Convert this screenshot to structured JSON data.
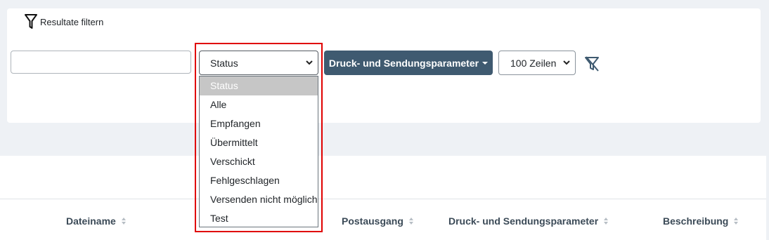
{
  "filter": {
    "header_label": "Resultate filtern",
    "search": {
      "value": "",
      "placeholder": ""
    },
    "status_select": {
      "selected": "Status",
      "options": [
        "Status",
        "Alle",
        "Empfangen",
        "Übermittelt",
        "Verschickt",
        "Fehlgeschlagen",
        "Versenden nicht möglich",
        "Test"
      ]
    },
    "druck_button_label": "Druck- und Sendungsparameter",
    "rows_select": {
      "selected": "100 Zeilen"
    }
  },
  "table": {
    "columns": [
      "Dateiname",
      "Postausgang",
      "Druck- und Sendungsparameter",
      "Beschreibung"
    ]
  },
  "colors": {
    "accent": "#3f5a70",
    "highlight": "#e00000",
    "selected_option_bg": "#c6c6c6"
  },
  "icons": {
    "filter_header": "filter-icon",
    "clear_filter": "filter-clear-icon",
    "select_arrow": "chevron-down-icon",
    "sort": "sort-icon"
  }
}
